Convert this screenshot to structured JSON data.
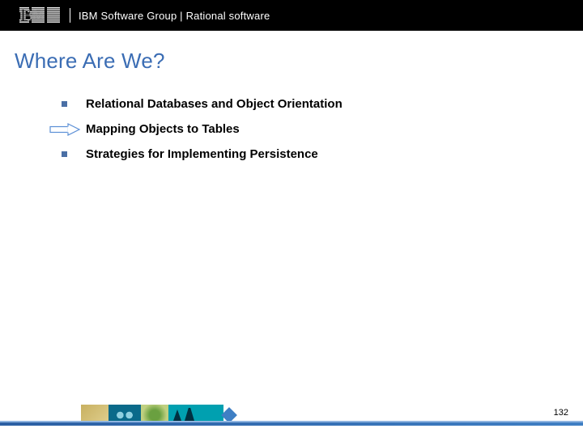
{
  "header": {
    "logo_alt": "IBM",
    "text": "IBM Software Group | Rational software"
  },
  "title": "Where Are We?",
  "bullets": [
    {
      "text": "Relational Databases and Object Orientation",
      "current": false
    },
    {
      "text": "Mapping Objects to Tables",
      "current": true
    },
    {
      "text": "Strategies for Implementing Persistence",
      "current": false
    }
  ],
  "page_number": "132",
  "colors": {
    "title": "#3b6db4",
    "bullet": "#4a6fa5",
    "arrow": "#5b8fd6"
  }
}
